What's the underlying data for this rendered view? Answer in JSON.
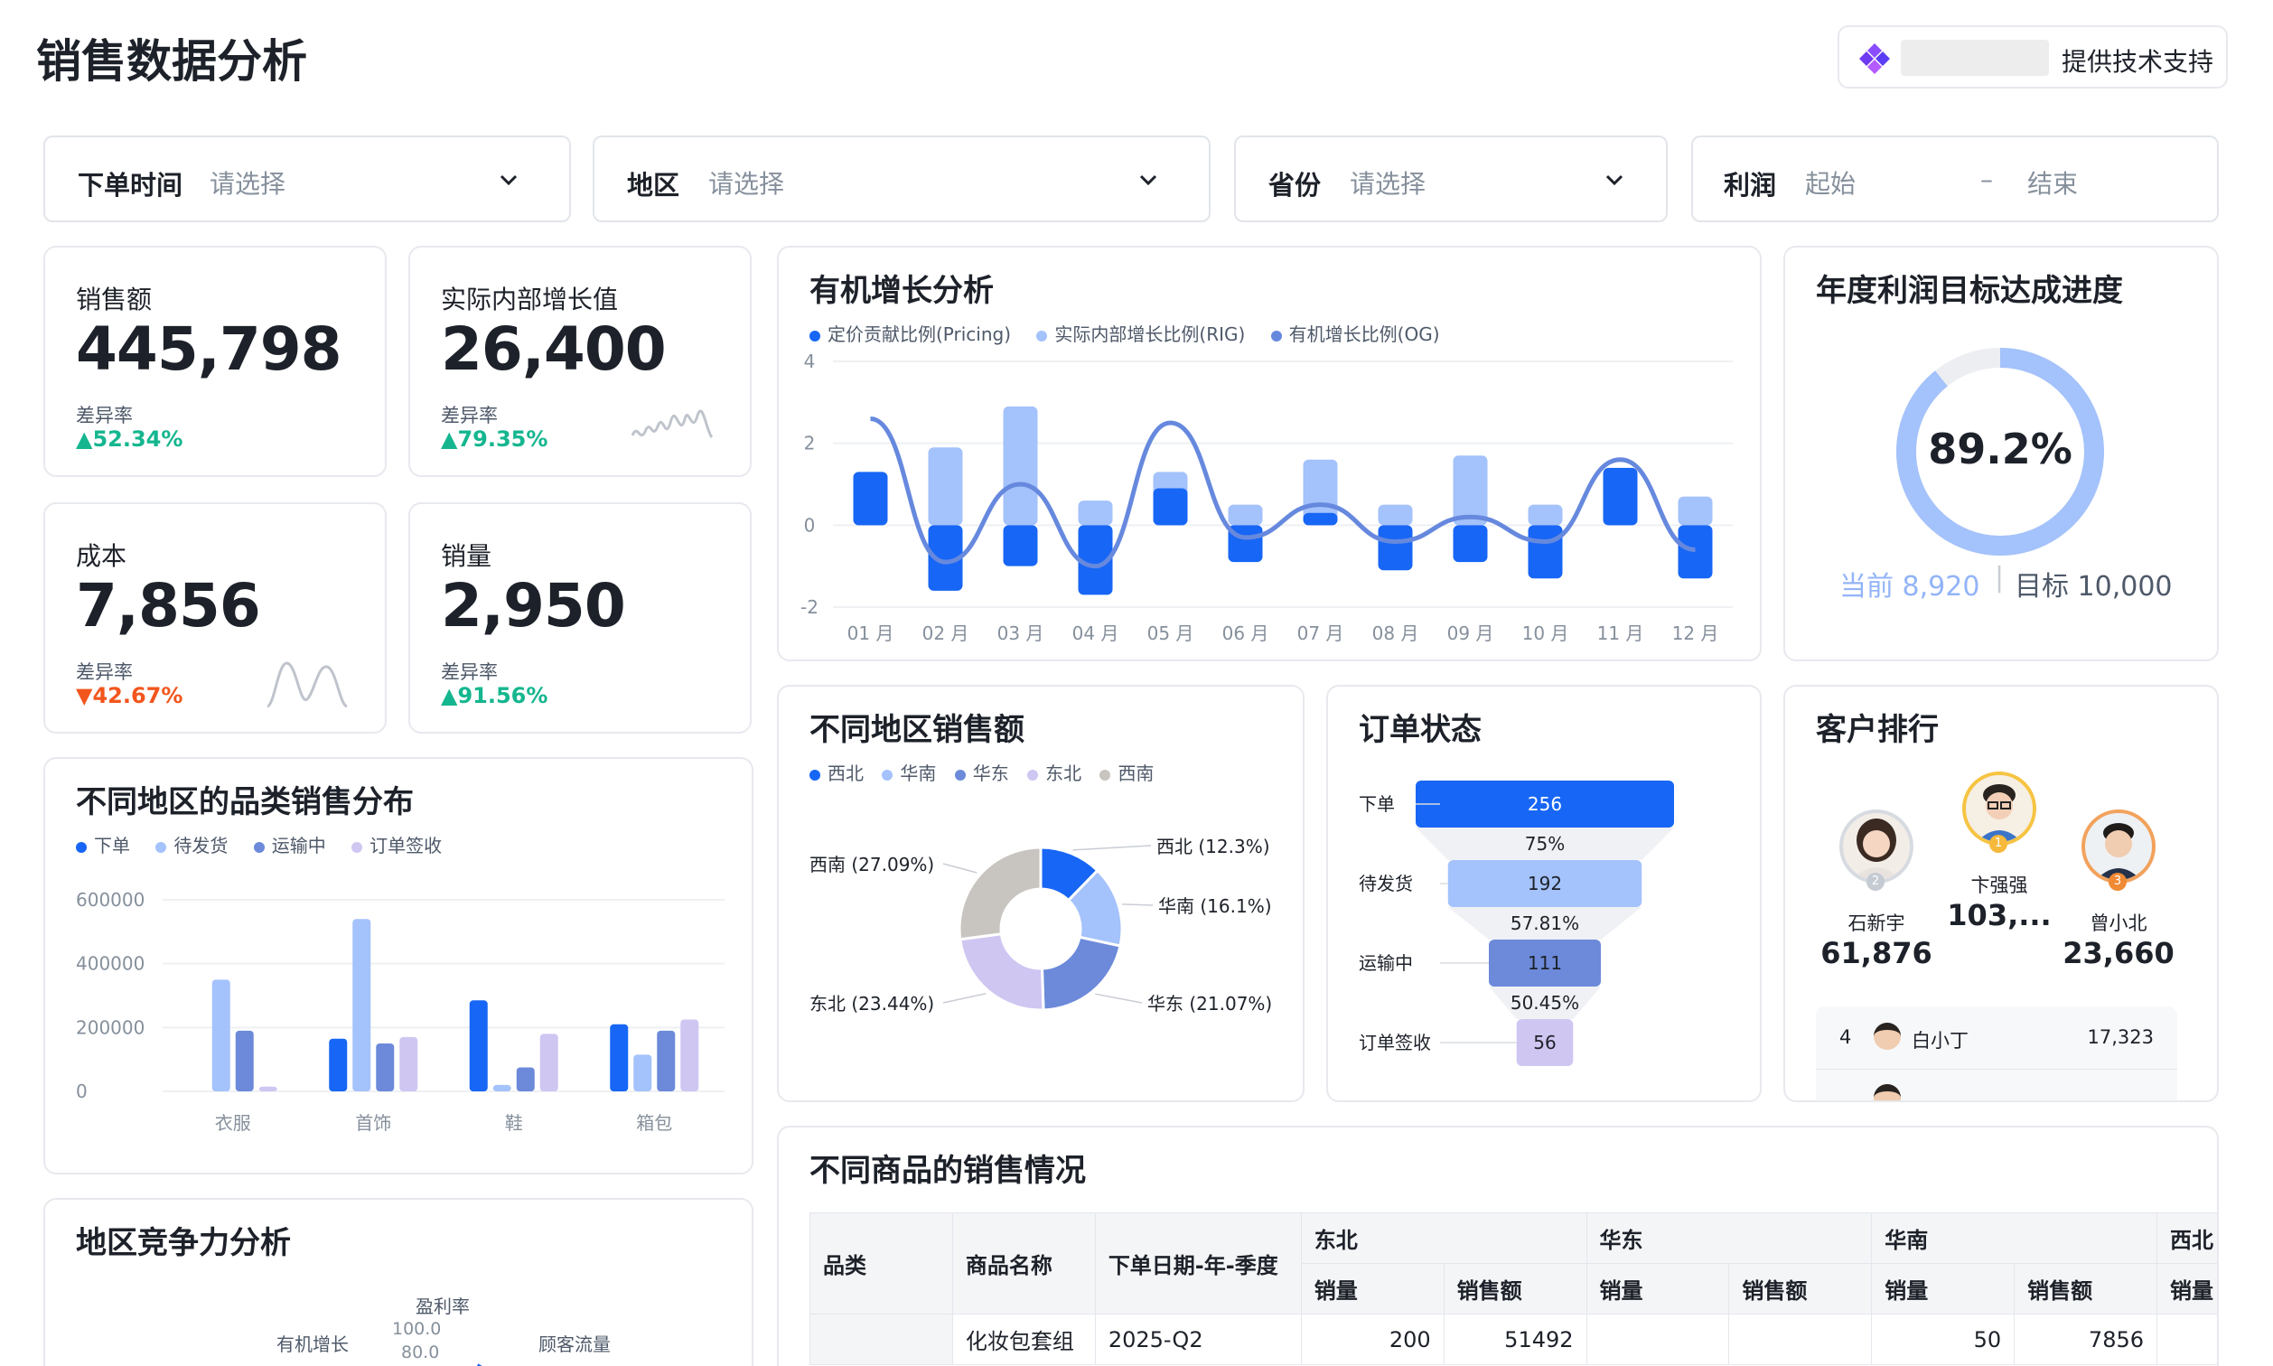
{
  "header": {
    "title": "销售数据分析",
    "support_label": "提供技术支持"
  },
  "filters": [
    {
      "label": "下单时间",
      "placeholder": "请选择"
    },
    {
      "label": "地区",
      "placeholder": "请选择"
    },
    {
      "label": "省份",
      "placeholder": "请选择"
    },
    {
      "label": "利润",
      "start": "起始",
      "sep": "–",
      "end": "结束"
    }
  ],
  "kpis": [
    {
      "label": "销售额",
      "value": "445,798",
      "diff_label": "差异率",
      "rate": "52.34%",
      "trend": "up"
    },
    {
      "label": "实际内部增长值",
      "value": "26,400",
      "diff_label": "差异率",
      "rate": "79.35%",
      "trend": "up"
    },
    {
      "label": "成本",
      "value": "7,856",
      "diff_label": "差异率",
      "rate": "42.67%",
      "trend": "down"
    },
    {
      "label": "销量",
      "value": "2,950",
      "diff_label": "差异率",
      "rate": "91.56%",
      "trend": "up"
    }
  ],
  "organic": {
    "title": "有机增长分析",
    "chart_data": {
      "type": "bar",
      "categories": [
        "01 月",
        "02 月",
        "03 月",
        "04 月",
        "05 月",
        "06 月",
        "07 月",
        "08 月",
        "09 月",
        "10 月",
        "11 月",
        "12 月"
      ],
      "ylim": [
        -2,
        4
      ],
      "yticks": [
        "4",
        "2",
        "0",
        "-2"
      ],
      "series": [
        {
          "name": "定价贡献比例(Pricing)",
          "color": "#1766f5",
          "values": [
            1.3,
            -1.6,
            -1.0,
            -1.7,
            0.9,
            -0.9,
            0.3,
            -1.1,
            -0.9,
            -1.3,
            1.4,
            -1.3
          ]
        },
        {
          "name": "实际内部增长比例(RIG)",
          "color": "#a4c2fb",
          "values": [
            1.3,
            1.9,
            2.9,
            0.6,
            1.3,
            0.5,
            1.6,
            0.5,
            1.7,
            0.5,
            0.2,
            0.7
          ]
        },
        {
          "name": "有机增长比例(OG)",
          "color": "#6689de",
          "values": [
            2.6,
            -0.9,
            1.0,
            -1.0,
            2.5,
            -0.3,
            0.5,
            -0.4,
            0.2,
            -0.4,
            1.6,
            -0.6
          ]
        }
      ]
    }
  },
  "profit_target": {
    "title": "年度利润目标达成进度",
    "percent": "89.2%",
    "current": "当前 8,920",
    "sep": "|",
    "target": "目标 10,000",
    "chart_data": {
      "type": "pie",
      "values": [
        89.2,
        10.8
      ]
    }
  },
  "category": {
    "title": "不同地区的品类销售分布",
    "chart_data": {
      "type": "bar",
      "categories": [
        "衣服",
        "首饰",
        "鞋",
        "箱包"
      ],
      "ylim": [
        0,
        600000
      ],
      "yticks": [
        "600000",
        "400000",
        "200000",
        "0"
      ],
      "series": [
        {
          "name": "下单",
          "color": "#1766f5",
          "values": [
            0,
            165000,
            285000,
            210000
          ]
        },
        {
          "name": "待发货",
          "color": "#a4c2fb",
          "values": [
            350000,
            540000,
            20000,
            115000
          ]
        },
        {
          "name": "运输中",
          "color": "#6c8ad9",
          "values": [
            190000,
            150000,
            75000,
            190000
          ]
        },
        {
          "name": "订单签收",
          "color": "#cfc6f2",
          "values": [
            15000,
            170000,
            180000,
            225000
          ]
        }
      ]
    }
  },
  "region_sales": {
    "title": "不同地区销售额",
    "chart_data": {
      "type": "pie",
      "labels": [
        "西北",
        "华南",
        "华东",
        "东北",
        "西南"
      ],
      "values": [
        12.3,
        16.1,
        21.07,
        23.44,
        27.09
      ],
      "colors": [
        "#1766f5",
        "#a4c2fb",
        "#6c8ad9",
        "#cfc6f2",
        "#c8c4c0"
      ],
      "slice_labels": [
        "西北 (12.3%)",
        "华南 (16.1%)",
        "华东 (21.07%)",
        "东北 (23.44%)",
        "西南 (27.09%)"
      ]
    }
  },
  "order_status": {
    "title": "订单状态",
    "chart_data": {
      "type": "bar",
      "categories": [
        "下单",
        "待发货",
        "运输中",
        "订单签收"
      ],
      "values": [
        256,
        192,
        111,
        56
      ],
      "value_labels": [
        "256",
        "192",
        "111",
        "56"
      ],
      "conversions": [
        "75%",
        "57.81%",
        "50.45%"
      ],
      "colors": [
        "#1766f5",
        "#a4c2fb",
        "#6c8ad9",
        "#cfc6f2"
      ]
    }
  },
  "customers": {
    "title": "客户排行",
    "top": [
      {
        "rank": "2",
        "name": "石新宇",
        "value": "61,876"
      },
      {
        "rank": "1",
        "name": "卞强强",
        "value": "103,..."
      },
      {
        "rank": "3",
        "name": "曾小北",
        "value": "23,660"
      }
    ],
    "list": [
      {
        "rank": "4",
        "name": "白小丁",
        "value": "17,323"
      }
    ]
  },
  "region_comp": {
    "title": "地区竞争力分析",
    "axes": [
      "盈利率",
      "有机增长",
      "顾客流量"
    ],
    "ticks": [
      "100.0",
      "80.0"
    ]
  },
  "product_table": {
    "title": "不同商品的销售情况",
    "head": {
      "category": "品类",
      "product": "商品名称",
      "date": "下单日期-年-季度",
      "regions": [
        "东北",
        "华东",
        "华南",
        "西北"
      ],
      "qty": "销量",
      "amount": "销售额"
    },
    "rows": [
      {
        "category": "",
        "product": "化妆包套组",
        "date": "2025-Q2",
        "cells": [
          "200",
          "51492",
          "",
          "",
          "50",
          "7856",
          ""
        ]
      }
    ]
  }
}
